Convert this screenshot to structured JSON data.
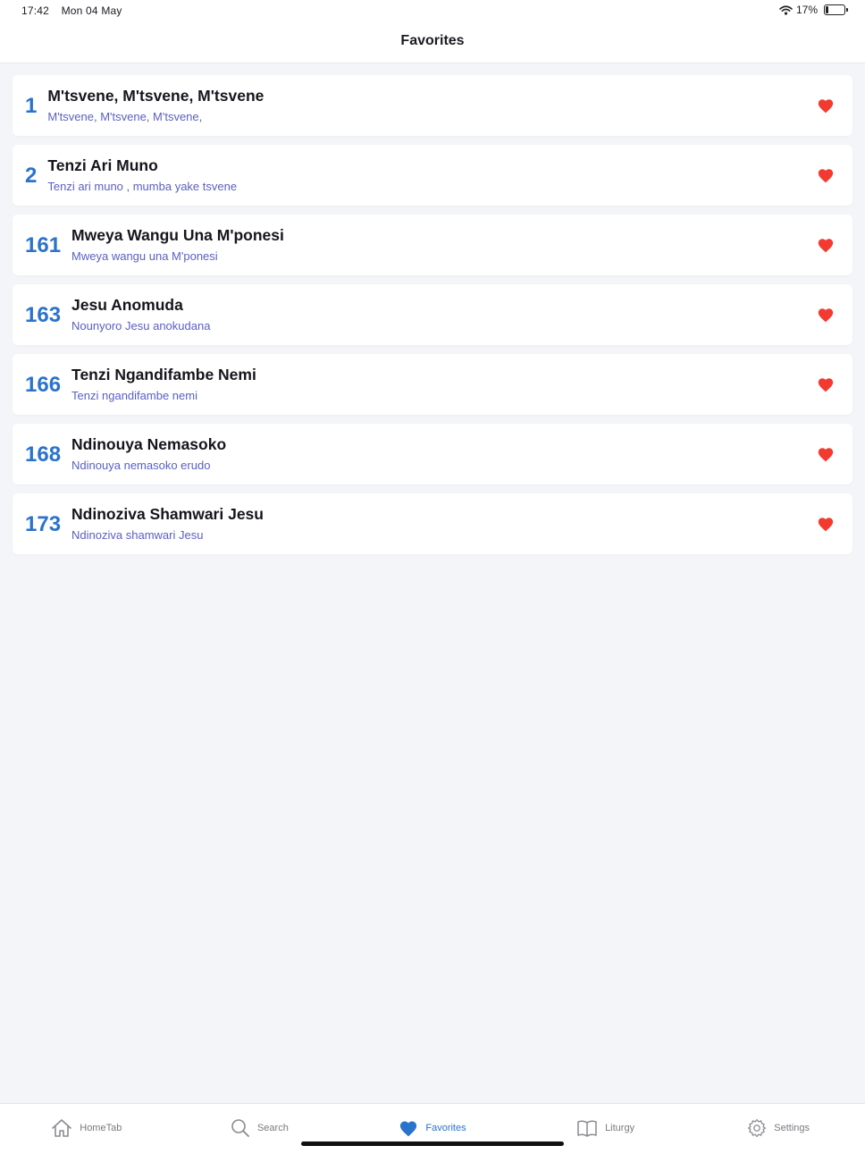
{
  "status": {
    "time": "17:42",
    "date": "Mon 04 May",
    "battery": "17%",
    "battery_level": 0.17
  },
  "header": {
    "title": "Favorites"
  },
  "favorites": [
    {
      "number": "1",
      "title": "M'tsvene, M'tsvene, M'tsvene",
      "subtitle": "M'tsvene, M'tsvene, M'tsvene,"
    },
    {
      "number": "2",
      "title": "Tenzi Ari Muno",
      "subtitle": "Tenzi ari muno , mumba yake tsvene"
    },
    {
      "number": "161",
      "title": "Mweya Wangu Una M'ponesi",
      "subtitle": "Mweya wangu una M'ponesi"
    },
    {
      "number": "163",
      "title": "Jesu Anomuda",
      "subtitle": "Nounyoro Jesu anokudana"
    },
    {
      "number": "166",
      "title": "Tenzi Ngandifambe Nemi",
      "subtitle": "Tenzi ngandifambe nemi"
    },
    {
      "number": "168",
      "title": "Ndinouya Nemasoko",
      "subtitle": "Ndinouya nemasoko erudo"
    },
    {
      "number": "173",
      "title": "Ndinoziva Shamwari Jesu",
      "subtitle": "Ndinoziva shamwari Jesu"
    }
  ],
  "tabs": [
    {
      "label": "HomeTab",
      "icon": "home-icon"
    },
    {
      "label": "Search",
      "icon": "search-icon"
    },
    {
      "label": "Favorites",
      "icon": "heart-icon"
    },
    {
      "label": "Liturgy",
      "icon": "book-icon"
    },
    {
      "label": "Settings",
      "icon": "gear-icon"
    }
  ],
  "colors": {
    "accent": "#2a73cc",
    "heart": "#f23a30",
    "subtitle": "#5a5fc4",
    "background": "#f4f5f9"
  }
}
